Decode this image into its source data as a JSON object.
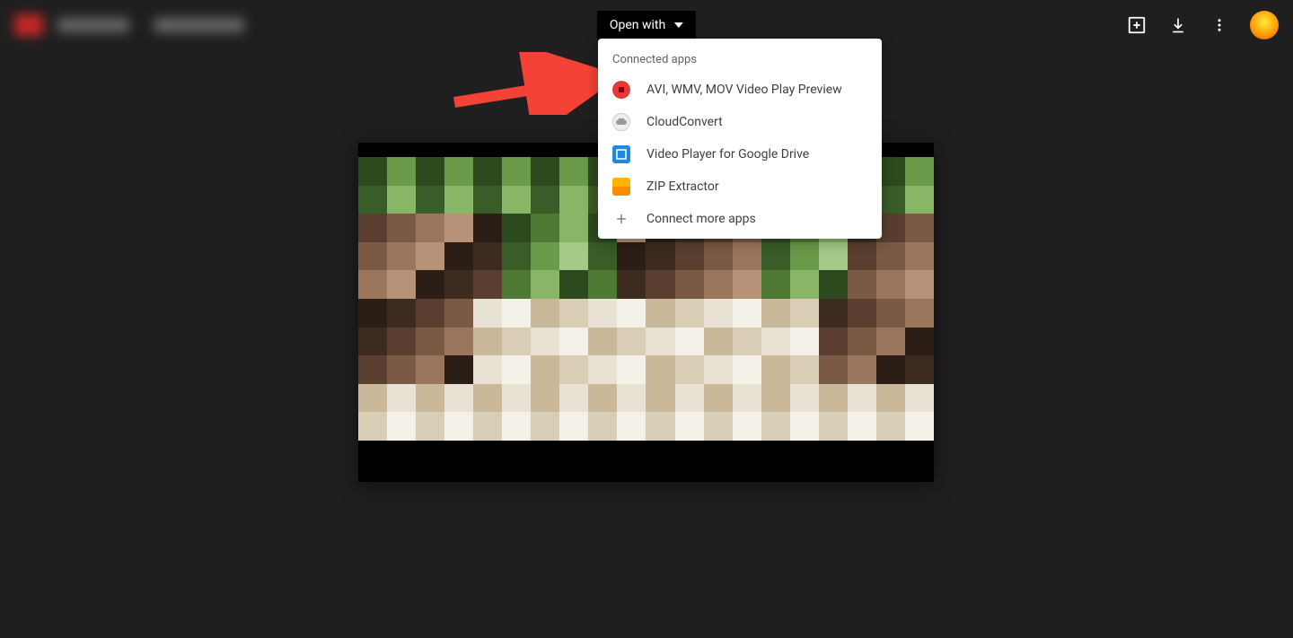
{
  "header": {
    "open_with_label": "Open with"
  },
  "dropdown": {
    "section_header": "Connected apps",
    "items": [
      {
        "label": "AVI, WMV, MOV Video Play Preview",
        "icon": "avi"
      },
      {
        "label": "CloudConvert",
        "icon": "cloud"
      },
      {
        "label": "Video Player for Google Drive",
        "icon": "video"
      },
      {
        "label": "ZIP Extractor",
        "icon": "zip"
      }
    ],
    "connect_more": "Connect more apps"
  },
  "annotation": {
    "arrow_color": "#f44336"
  }
}
